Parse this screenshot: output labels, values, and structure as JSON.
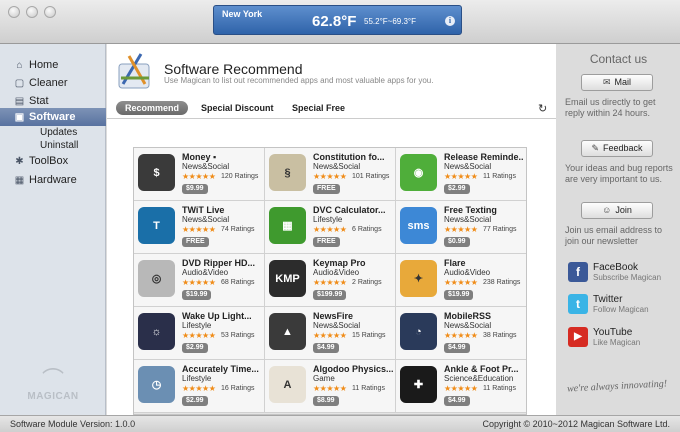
{
  "weather": {
    "city": "New York",
    "temp": "62.8°F",
    "range": "55.2°F~69.3°F"
  },
  "sidebar": {
    "items": [
      {
        "label": "Home",
        "icon": "home-icon"
      },
      {
        "label": "Cleaner",
        "icon": "cleaner-icon"
      },
      {
        "label": "Stat",
        "icon": "stat-icon"
      },
      {
        "label": "Software",
        "icon": "software-icon"
      },
      {
        "label": "ToolBox",
        "icon": "toolbox-icon"
      },
      {
        "label": "Hardware",
        "icon": "hardware-icon"
      }
    ],
    "sub_items": [
      "Updates",
      "Uninstall"
    ],
    "logo_text": "MAGICAN"
  },
  "main": {
    "title": "Software Recommend",
    "subtitle": "Use Magican to list out recommended apps and most valuable apps for you.",
    "tabs": [
      "Recommend",
      "Special Discount",
      "Special Free"
    ]
  },
  "apps": [
    {
      "name": "Money ▪",
      "category": "News&Social",
      "ratings": "120 Ratings",
      "price": "$9.99",
      "color": "#3a3a3a",
      "glyph": "$"
    },
    {
      "name": "Constitution fo...",
      "category": "News&Social",
      "ratings": "101 Ratings",
      "price": "FREE",
      "color": "#c9bfa2",
      "glyph": "§"
    },
    {
      "name": "Release Reminde...",
      "category": "News&Social",
      "ratings": "11 Ratings",
      "price": "$2.99",
      "color": "#4fae3a",
      "glyph": "◉"
    },
    {
      "name": "TWiT Live",
      "category": "News&Social",
      "ratings": "74 Ratings",
      "price": "FREE",
      "color": "#1a6fa8",
      "glyph": "T"
    },
    {
      "name": "DVC Calculator...",
      "category": "Lifestyle",
      "ratings": "6 Ratings",
      "price": "FREE",
      "color": "#3f9a2e",
      "glyph": "▦"
    },
    {
      "name": "Free Texting",
      "category": "News&Social",
      "ratings": "77 Ratings",
      "price": "$0.99",
      "color": "#3d88d6",
      "glyph": "sms"
    },
    {
      "name": "DVD Ripper HD...",
      "category": "Audio&Video",
      "ratings": "68 Ratings",
      "price": "$19.99",
      "color": "#b8b8b8",
      "glyph": "◎"
    },
    {
      "name": "Keymap Pro",
      "category": "Audio&Video",
      "ratings": "2 Ratings",
      "price": "$199.99",
      "color": "#2c2c2c",
      "glyph": "KMP"
    },
    {
      "name": "Flare",
      "category": "Audio&Video",
      "ratings": "238 Ratings",
      "price": "$19.99",
      "color": "#e8a93a",
      "glyph": "✦"
    },
    {
      "name": "Wake Up Light...",
      "category": "Lifestyle",
      "ratings": "53 Ratings",
      "price": "$2.99",
      "color": "#2a2f4a",
      "glyph": "☼"
    },
    {
      "name": "NewsFire",
      "category": "News&Social",
      "ratings": "15 Ratings",
      "price": "$4.99",
      "color": "#3a3a3a",
      "glyph": "▲"
    },
    {
      "name": "MobileRSS",
      "category": "News&Social",
      "ratings": "38 Ratings",
      "price": "$4.99",
      "color": "#2a3a5a",
      "glyph": "◔"
    },
    {
      "name": "Accurately Time...",
      "category": "Lifestyle",
      "ratings": "16 Ratings",
      "price": "$2.99",
      "color": "#6b8fb3",
      "glyph": "◷"
    },
    {
      "name": "Algodoo Physics...",
      "category": "Game",
      "ratings": "11 Ratings",
      "price": "$8.99",
      "color": "#e8e2d6",
      "glyph": "A"
    },
    {
      "name": "Ankle & Foot Pr...",
      "category": "Science&Education",
      "ratings": "11 Ratings",
      "price": "$4.99",
      "color": "#1a1a1a",
      "glyph": "✚"
    }
  ],
  "right": {
    "title": "Contact us",
    "mail_label": "Mail",
    "mail_note": "Email us directly to get reply within 24 hours.",
    "feedback_label": "Feedback",
    "feedback_note": "Your ideas and bug reports are very important to us.",
    "join_label": "Join",
    "join_note": "Join us email address to join our newsletter",
    "social": [
      {
        "title": "FaceBook",
        "sub": "Subscribe Magican",
        "color": "#3b5998",
        "glyph": "f"
      },
      {
        "title": "Twitter",
        "sub": "Follow Magican",
        "color": "#3ab4e6",
        "glyph": "t"
      },
      {
        "title": "YouTube",
        "sub": "Like Magican",
        "color": "#d62b22",
        "glyph": "▶"
      }
    ],
    "slogan": "we're always innovating!"
  },
  "status": {
    "version": "Software Module Version: 1.0.0",
    "copyright": "Copyright © 2010~2012 Magican Software Ltd."
  }
}
